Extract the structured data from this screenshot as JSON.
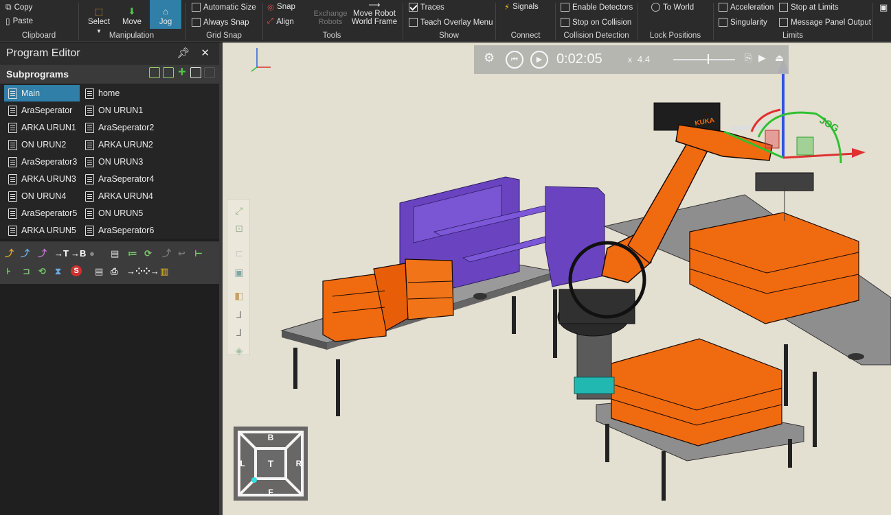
{
  "ribbon": {
    "clipboard": {
      "copy": "Copy",
      "paste": "Paste",
      "label": "Clipboard"
    },
    "manipulation": {
      "select": "Select",
      "move": "Move",
      "jog": "Jog",
      "label": "Manipulation"
    },
    "grid_snap": {
      "automatic_size": "Automatic Size",
      "always_snap": "Always Snap",
      "label": "Grid Snap"
    },
    "tools": {
      "snap": "Snap",
      "align": "Align",
      "exchange_robots": "Exchange Robots",
      "move_robot_world_frame": "Move Robot World Frame",
      "label": "Tools"
    },
    "show": {
      "traces": "Traces",
      "teach_overlay_menu": "Teach Overlay Menu",
      "label": "Show"
    },
    "connect": {
      "signals": "Signals",
      "label": "Connect"
    },
    "collision_detection": {
      "enable_detectors": "Enable Detectors",
      "stop_on_collision": "Stop on Collision",
      "label": "Collision Detection"
    },
    "lock_positions": {
      "to_world": "To World",
      "label": "Lock Positions"
    },
    "limits": {
      "acceleration": "Acceleration",
      "singularity": "Singularity",
      "stop_at_limits": "Stop at Limits",
      "message_panel_output": "Message Panel Output",
      "label": "Limits"
    }
  },
  "program_editor": {
    "title": "Program Editor",
    "subprograms_title": "Subprograms",
    "subprograms": [
      "Main",
      "home",
      "AraSeperator",
      "ON URUN1",
      "ARKA URUN1",
      "AraSeperator2",
      "ON URUN2",
      "ARKA URUN2",
      "AraSeperator3",
      "ON URUN3",
      "ARKA URUN3",
      "AraSeperator4",
      "ON URUN4",
      "ARKA URUN4",
      "AraSeperator5",
      "ON URUN5",
      "ARKA URUN5",
      "AraSeperator6"
    ],
    "selected": "Main"
  },
  "playback": {
    "time": "0:02:05",
    "speed_prefix": "x",
    "speed": "4.4"
  },
  "navcube": {
    "top": "B",
    "left": "L",
    "center": "T",
    "right": "R",
    "bottom": "F"
  },
  "scene": {
    "robot_brand": "KUKA",
    "jog_label": "JOG"
  },
  "colors": {
    "accent": "#2f7fa8",
    "robot": "#f06a10",
    "fixture": "#7048c8",
    "background": "#e3dfd1"
  }
}
